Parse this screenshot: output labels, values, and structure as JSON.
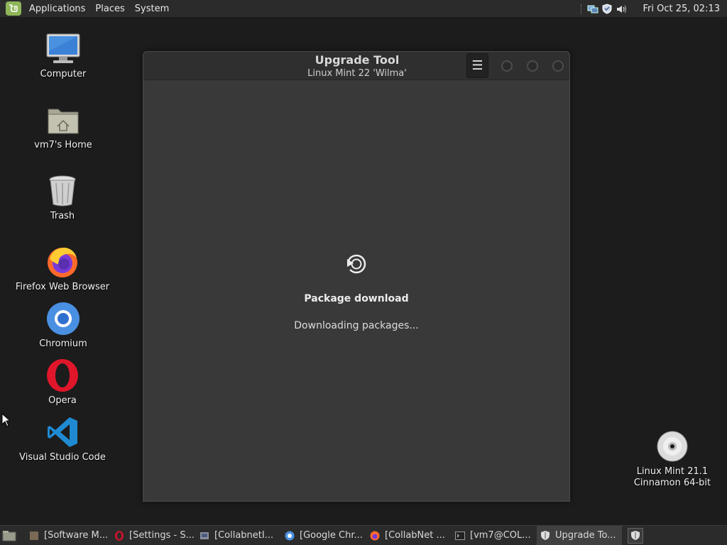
{
  "top_panel": {
    "menus": [
      "Applications",
      "Places",
      "System"
    ],
    "clock": "Fri Oct 25, 02:13",
    "tray_icons": [
      "network-icon",
      "shield-icon",
      "volume-icon"
    ]
  },
  "desktop": {
    "icons": [
      {
        "label": "Computer",
        "icon": "computer-icon"
      },
      {
        "label": "vm7's Home",
        "icon": "home-folder-icon"
      },
      {
        "label": "Trash",
        "icon": "trash-icon"
      },
      {
        "label": "Firefox Web Browser",
        "icon": "firefox-icon"
      },
      {
        "label": "Chromium",
        "icon": "chromium-icon"
      },
      {
        "label": "Opera",
        "icon": "opera-icon"
      },
      {
        "label": "Visual Studio Code",
        "icon": "vscode-icon"
      }
    ],
    "disc": {
      "line1": "Linux Mint 21.1",
      "line2": "Cinnamon 64-bit",
      "icon": "disc-icon"
    }
  },
  "window": {
    "title": "Upgrade Tool",
    "subtitle": "Linux Mint 22 'Wilma'",
    "menu_button": "☰",
    "status_title": "Package download",
    "status_text": "Downloading packages..."
  },
  "taskbar": {
    "tasks": [
      {
        "label": "[Software M...",
        "icon": "software-manager-icon"
      },
      {
        "label": "[Settings - S...",
        "icon": "opera-icon"
      },
      {
        "label": "[CollabnetI...",
        "icon": "app-icon"
      },
      {
        "label": "[Google Chr...",
        "icon": "chrome-icon"
      },
      {
        "label": "[CollabNet ...",
        "icon": "firefox-icon"
      },
      {
        "label": "[vm7@COL...",
        "icon": "terminal-icon"
      },
      {
        "label": "Upgrade To...",
        "icon": "shield-icon",
        "active": true
      }
    ]
  },
  "colors": {
    "panel": "#2b2b2b",
    "window_bg": "#393939",
    "mint_green": "#8fb65a"
  }
}
